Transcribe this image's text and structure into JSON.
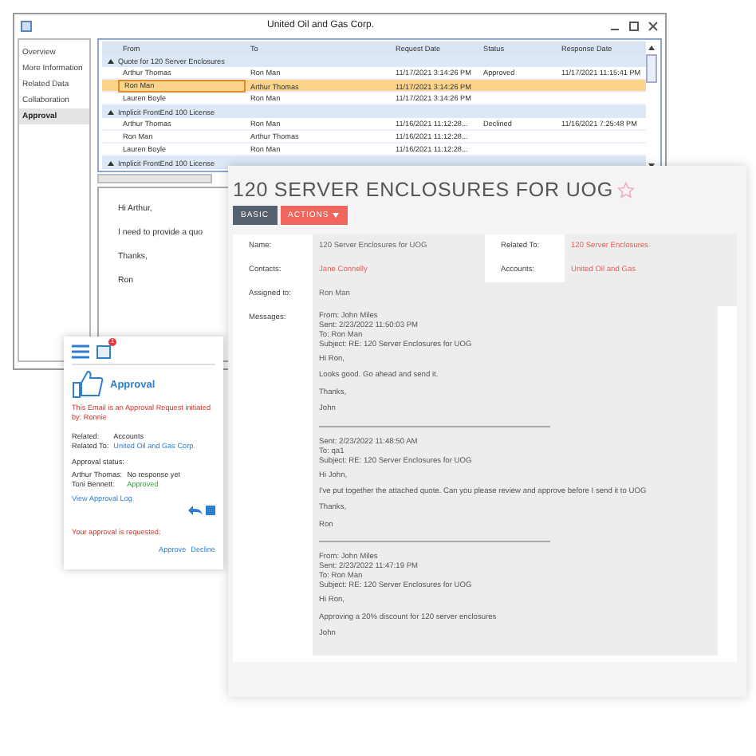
{
  "crm_window": {
    "title": "United Oil and Gas Corp.",
    "sidebar": [
      {
        "label": "Overview",
        "selected": false
      },
      {
        "label": "More Information",
        "selected": false
      },
      {
        "label": "Related Data",
        "selected": false
      },
      {
        "label": "Collaboration",
        "selected": false
      },
      {
        "label": "Approval",
        "selected": true
      }
    ],
    "table": {
      "columns": [
        "From",
        "To",
        "Request Date",
        "Status",
        "Response Date"
      ],
      "groups": [
        {
          "title": "Quote for 120 Server Enclosures",
          "expanded": true,
          "rows": [
            {
              "cells": [
                "Arthur Thomas",
                "Ron Man",
                "11/17/2021 3:14:26 PM",
                "Approved",
                "11/17/2021 11:15:41 PM"
              ],
              "selected": false
            },
            {
              "cells": [
                "Ron Man",
                "Arthur Thomas",
                "11/17/2021 3:14:26 PM",
                "",
                ""
              ],
              "selected": true
            },
            {
              "cells": [
                "Lauren Boyle",
                "Ron Man",
                "11/17/2021 3:14:26 PM",
                "",
                ""
              ],
              "selected": false
            }
          ]
        },
        {
          "title": "Implicit FrontEnd 100 License",
          "expanded": true,
          "rows": [
            {
              "cells": [
                "Arthur Thomas",
                "Ron Man",
                "11/16/2021 11:12:28...",
                "Declined",
                "11/16/2021 7:25:48 PM"
              ],
              "selected": false
            },
            {
              "cells": [
                "Ron Man",
                "Arthur Thomas",
                "11/16/2021 11:12:28...",
                "",
                ""
              ],
              "selected": false
            },
            {
              "cells": [
                "Lauren Boyle",
                "Ron Man",
                "11/16/2021 11:12:28...",
                "",
                ""
              ],
              "selected": false
            }
          ]
        },
        {
          "title": "Implicit FrontEnd 100 License",
          "expanded": true
        }
      ]
    },
    "email_preview": [
      "Hi Arthur,",
      "I need to provide a quo",
      "Thanks,",
      "Ron"
    ]
  },
  "record": {
    "title": "120 SERVER ENCLOSURES FOR UOG",
    "starred": false,
    "buttons": [
      {
        "label": "BASIC",
        "kind": "view"
      },
      {
        "label": "ACTIONS",
        "kind": "menu"
      }
    ],
    "fields": [
      {
        "label": "Name:",
        "value": "120 Server Enclosures for UOG",
        "link": false
      },
      {
        "label": "Related To:",
        "value": "120 Server Enclosures",
        "link": true
      },
      {
        "label": "Contacts:",
        "value": "Jane Connelly",
        "link": true
      },
      {
        "label": "Accounts:",
        "value": "United Oil and Gas",
        "link": true
      },
      {
        "label": "Assigned to:",
        "value": "Ron Man",
        "link": false
      }
    ],
    "messages_label": "Messages:",
    "messages": [
      {
        "header": [
          "From:  John Miles",
          "Sent: 2/23/2022 11:50:03 PM",
          "To: Ron Man",
          "Subject: RE: 120 Server Enclosures for UOG"
        ],
        "body": [
          "Hi Ron,",
          "Looks good. Go ahead and send it.",
          "Thanks,",
          "John"
        ]
      },
      {
        "header": [
          "Sent: 2/23/2022 11:48:50 AM",
          "To: qa1",
          "Subject: RE: 120 Server Enclosures for UOG"
        ],
        "body": [
          "Hi John,",
          "I've put together the attached quote. Can you please review and approve before I send it to UOG",
          "Thanks,",
          "Ron"
        ]
      },
      {
        "header": [
          "From:  John Miles",
          "Sent: 2/23/2022 11:47:19 PM",
          "To: Ron Man",
          "Subject: RE: 120 Server Enclosures for UOG"
        ],
        "body": [
          "Hi Ron,",
          "Approving a 20% discount for 120 server enclosures",
          "John"
        ]
      }
    ]
  },
  "approval_pane": {
    "badge": "1",
    "title": "Approval",
    "notice": "This Email is an Approval Request initiated by: Ronnie",
    "related_label": "Related:",
    "related": "Accounts",
    "related_to_label": "Related To:",
    "related_to": "United Oil and Gas Corp.",
    "status_label": "Approval status:",
    "approvers": [
      {
        "name": "Arthur Thomas:",
        "status": "No response yet",
        "approved": false
      },
      {
        "name": "Toni Bennett:",
        "status": "Approved",
        "approved": true
      }
    ],
    "log_link": "View Approval Log",
    "request": "Your approval is requested:",
    "actions": [
      "Approve",
      "Decline"
    ]
  }
}
